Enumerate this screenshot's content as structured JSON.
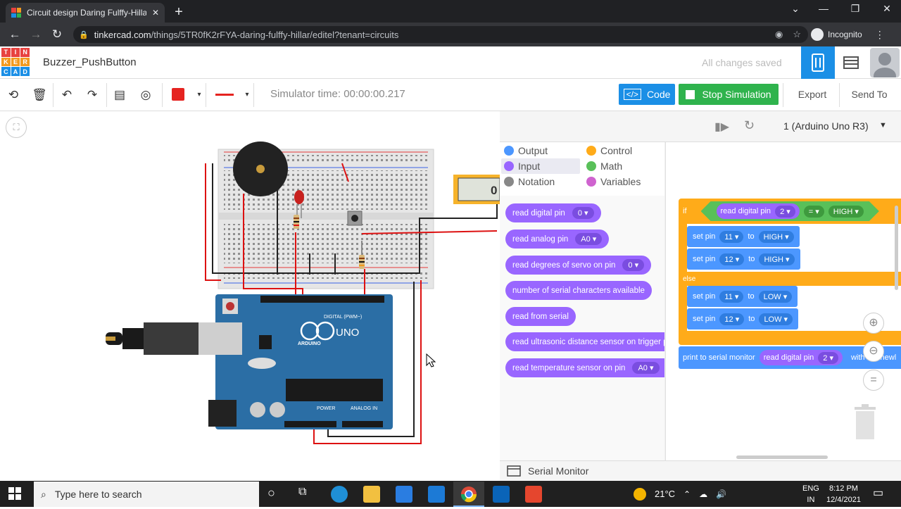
{
  "browser": {
    "tab_title": "Circuit design Daring Fulffy-Hillar",
    "tab_close": "✕",
    "new_tab": "+",
    "url_host": "tinkercad.com",
    "url_path": "/things/5TR0fK2rFYA-daring-fulffy-hillar/editel?tenant=circuits",
    "incognito_label": "Incognito",
    "window_controls": [
      "⌄",
      "—",
      "❐",
      "✕"
    ]
  },
  "header": {
    "logo_letters": [
      "T",
      "I",
      "N",
      "K",
      "E",
      "R",
      "C",
      "A",
      "D"
    ],
    "logo_colors": [
      "#e8423f",
      "#e8423f",
      "#e8423f",
      "#f39a1f",
      "#f39a1f",
      "#f39a1f",
      "#1b8fe6",
      "#1b8fe6",
      "#1b8fe6"
    ],
    "project_name": "Buzzer_PushButton",
    "save_status": "All changes saved"
  },
  "toolbar": {
    "sim_time": "Simulator time: 00:00:00.217",
    "code_label": "Code",
    "stop_label": "Stop Simulation",
    "export_label": "Export",
    "send_label": "Send To",
    "wire_color": "#e52320"
  },
  "circuit": {
    "multimeter_value": "0",
    "arduino_label": "UNO",
    "arduino_brand": "ARDUINO",
    "digital_label": "DIGITAL (PWM~)",
    "power_label": "POWER",
    "analog_label": "ANALOG IN"
  },
  "code_panel": {
    "device": "1 (Arduino Uno R3)",
    "categories_col1": [
      {
        "label": "Output",
        "color": "#4c97ff"
      },
      {
        "label": "Input",
        "color": "#9966ff"
      },
      {
        "label": "Notation",
        "color": "#888888"
      }
    ],
    "categories_col2": [
      {
        "label": "Control",
        "color": "#ffab19"
      },
      {
        "label": "Math",
        "color": "#59c059"
      },
      {
        "label": "Variables",
        "color": "#cf63cf"
      }
    ],
    "palette_blocks": [
      {
        "text": "read digital pin",
        "dd": "0 ▾"
      },
      {
        "text": "read analog pin",
        "dd": "A0 ▾"
      },
      {
        "text": "read degrees of servo on pin",
        "dd": "0 ▾"
      },
      {
        "text": "number of serial characters available",
        "dd": ""
      },
      {
        "text": "read from serial",
        "dd": ""
      },
      {
        "text": "read ultrasonic distance sensor on trigger p",
        "dd": ""
      },
      {
        "text": "read temperature sensor on pin",
        "dd": "A0 ▾"
      }
    ],
    "script": {
      "if_label": "if",
      "read_pin_label": "read digital pin",
      "read_pin_value": "2 ▾",
      "op_value": "= ▾",
      "high_value": "HIGH ▾",
      "set_pin_label": "set pin",
      "to_label": "to",
      "pin_11": "11 ▾",
      "pin_12": "12 ▾",
      "high": "HIGH ▾",
      "low": "LOW ▾",
      "else_label": "else",
      "print_label": "print to serial monitor",
      "with_label": "with",
      "newline_label": "newl"
    },
    "serial_monitor_label": "Serial Monitor"
  },
  "taskbar": {
    "search_placeholder": "Type here to search",
    "weather": "21°C",
    "language": "ENG",
    "region": "IN",
    "time": "8:12 PM",
    "date": "12/4/2021"
  }
}
